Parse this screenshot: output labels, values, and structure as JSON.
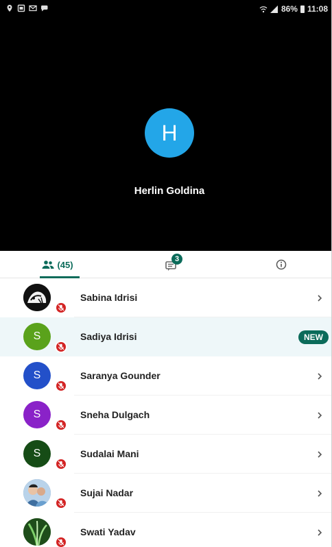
{
  "status_bar": {
    "battery": "86%",
    "time": "11:08",
    "left_icons": [
      "location-icon",
      "sim-icon",
      "mail-icon",
      "chat-notification-icon"
    ],
    "right_icons": [
      "wifi-calling-icon",
      "signal-icon",
      "battery-icon"
    ]
  },
  "call": {
    "avatar_initial": "H",
    "avatar_color": "#23a6e8",
    "caller_name": "Herlin Goldina"
  },
  "tabs": {
    "people_count": "(45)",
    "chat_unread": "3",
    "active": "people",
    "accent": "#0b6b5a"
  },
  "participants": [
    {
      "name": "Sabina Idrisi",
      "initial": "",
      "avatar_type": "photo",
      "avatar_color": "#111111",
      "muted": true,
      "new": false
    },
    {
      "name": "Sadiya Idrisi",
      "initial": "S",
      "avatar_type": "letter",
      "avatar_color": "#5aa21b",
      "muted": true,
      "new": true,
      "badge": "NEW"
    },
    {
      "name": "Saranya Gounder",
      "initial": "S",
      "avatar_type": "letter",
      "avatar_color": "#2350c9",
      "muted": true,
      "new": false
    },
    {
      "name": "Sneha Dulgach",
      "initial": "S",
      "avatar_type": "letter",
      "avatar_color": "#8a22c8",
      "muted": true,
      "new": false
    },
    {
      "name": "Sudalai Mani",
      "initial": "S",
      "avatar_type": "letter",
      "avatar_color": "#164c16",
      "muted": true,
      "new": false
    },
    {
      "name": "Sujai Nadar",
      "initial": "",
      "avatar_type": "photo",
      "avatar_color": "#6b8fb0",
      "muted": true,
      "new": false
    },
    {
      "name": "Swati Yadav",
      "initial": "",
      "avatar_type": "photo",
      "avatar_color": "#2f6a2a",
      "muted": true,
      "new": false
    }
  ]
}
